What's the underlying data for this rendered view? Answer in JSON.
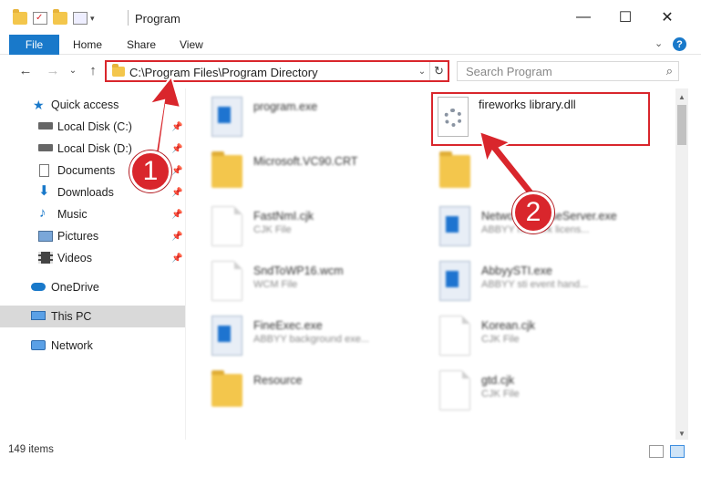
{
  "window": {
    "title": "Program",
    "minimize": "—",
    "maximize": "☐",
    "close": "✕"
  },
  "ribbon": {
    "file": "File",
    "tabs": [
      "Home",
      "Share",
      "View"
    ],
    "expand": "⌄",
    "help": "?"
  },
  "nav": {
    "back": "←",
    "forward": "→",
    "recent": "⌄",
    "up": "↑",
    "address": "C:\\Program Files\\Program Directory",
    "address_drop": "⌄",
    "refresh": "↻",
    "search_placeholder": "Search Program",
    "search_icon": "⌕"
  },
  "sidebar": {
    "quick_access": "Quick access",
    "items": [
      {
        "label": "Local Disk (C:)",
        "icon": "drive-icon"
      },
      {
        "label": "Local Disk (D:)",
        "icon": "drive-icon"
      },
      {
        "label": "Documents",
        "icon": "documents-icon"
      },
      {
        "label": "Downloads",
        "icon": "downloads-icon"
      },
      {
        "label": "Music",
        "icon": "music-icon"
      },
      {
        "label": "Pictures",
        "icon": "pictures-icon"
      },
      {
        "label": "Videos",
        "icon": "videos-icon"
      }
    ],
    "onedrive": "OneDrive",
    "thispc": "This PC",
    "network": "Network"
  },
  "files": [
    {
      "name": "program.exe",
      "type": "",
      "icon": "app"
    },
    {
      "name": "fireworks library.dll",
      "type": "",
      "icon": "dll"
    },
    {
      "name": "Microsoft.VC90.CRT",
      "type": "",
      "icon": "folder"
    },
    {
      "name": "",
      "type": "",
      "icon": "folder"
    },
    {
      "name": "FastNmI.cjk",
      "type": "CJK File",
      "icon": "doc"
    },
    {
      "name": "NetworkLicenseServer.exe",
      "type": "ABBYY network licens...",
      "icon": "app"
    },
    {
      "name": "SndToWP16.wcm",
      "type": "WCM File",
      "icon": "doc"
    },
    {
      "name": "AbbyySTI.exe",
      "type": "ABBYY sti event hand...",
      "icon": "app"
    },
    {
      "name": "FineExec.exe",
      "type": "ABBYY background exe...",
      "icon": "app"
    },
    {
      "name": "Korean.cjk",
      "type": "CJK File",
      "icon": "doc"
    },
    {
      "name": "Resource",
      "type": "",
      "icon": "folder"
    },
    {
      "name": "gtd.cjk",
      "type": "CJK File",
      "icon": "doc"
    }
  ],
  "status": {
    "count": "149 items"
  },
  "annotations": {
    "badge1": "1",
    "badge2": "2",
    "color": "#d9262c"
  }
}
